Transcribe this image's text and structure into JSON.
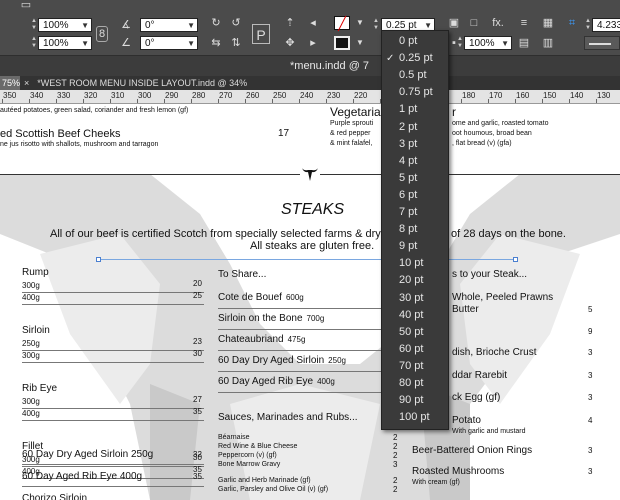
{
  "control_bar": {
    "scale_x": "100%",
    "scale_y": "100%",
    "rotate": "0°",
    "shear": "0°",
    "stroke_weight": "0.25 pt",
    "opacity": "100%",
    "ref_value": "4.233"
  },
  "window": {
    "title": "*menu.indd @ 7"
  },
  "tabs": {
    "active": "75%",
    "close_glyph": "×",
    "doc_tab": "*WEST ROOM MENU INSIDE LAYOUT.indd @ 34%"
  },
  "ruler": {
    "ticks": [
      "350",
      "340",
      "330",
      "320",
      "310",
      "300",
      "290",
      "280",
      "270",
      "260",
      "250",
      "240",
      "230",
      "220",
      "210",
      "200",
      "190",
      "180",
      "170",
      "160",
      "150",
      "140",
      "130"
    ]
  },
  "document": {
    "top_line1": "autéed potatoes, green salad, coriander and fresh lemon (gf)",
    "beef_cheeks": "ed Scottish Beef Cheeks",
    "beef_cheeks_price": "17",
    "beef_cheeks_desc": "ne jus risotto with shallots, mushroom and tarragon",
    "veg_title": "Vegetarian",
    "veg_title_end": "r",
    "veg_l1": "Purple sprouti",
    "veg_l1_end": "ome and garlic, roasted tomato",
    "veg_l2": "& red pepper",
    "veg_l2_end": "oot houmous, broad bean",
    "veg_l3": "& mint falafel,",
    "veg_l3_end": ", flat bread (v) (gfa)",
    "steaks_heading": "STEAKS",
    "intro_l1_a": "All of our beef is certified Scotch from specially selected farms & dry age",
    "intro_l1_b": "of 28 days on the bone.",
    "intro_l2": "All steaks are gluten free.",
    "col1": [
      {
        "name": "Rump",
        "rows": [
          [
            "300g",
            "20"
          ],
          [
            "400g",
            "25"
          ]
        ]
      },
      {
        "name": "Sirloin",
        "rows": [
          [
            "250g",
            "23"
          ],
          [
            "300g",
            "30"
          ]
        ]
      },
      {
        "name": "Rib Eye",
        "rows": [
          [
            "300g",
            "27"
          ],
          [
            "400g",
            "35"
          ]
        ]
      },
      {
        "name": "Fillet",
        "rows": [
          [
            "300g",
            "30"
          ],
          [
            "400g",
            "35"
          ]
        ]
      }
    ],
    "col1_extra": [
      {
        "name": "60 Day Dry Aged Sirloin 250g",
        "price": "32"
      },
      {
        "name": "60 Day Aged Rib Eye 400g",
        "price": "35"
      },
      {
        "name": "Chorizo Sirloin",
        "price": ""
      }
    ],
    "col2_title": "To Share...",
    "col2": [
      {
        "name": "Cote de Bouef",
        "weight": "600g"
      },
      {
        "name": "Sirloin on the Bone",
        "weight": "700g"
      },
      {
        "name": "Chateaubriand",
        "weight": "475g"
      },
      {
        "name": "60 Day Dry Aged Sirloin",
        "weight": "250g"
      },
      {
        "name": "60 Day Aged Rib Eye",
        "weight": "400g"
      }
    ],
    "sauces_title": "Sauces, Marinades and Rubs...",
    "sauces": [
      {
        "name": "Béarnaise",
        "price": "2"
      },
      {
        "name": "Red Wine & Blue Cheese",
        "price": "2"
      },
      {
        "name": "Peppercorn (v) (gf)",
        "price": "2"
      },
      {
        "name": "Bone Marrow Gravy",
        "price": "3"
      },
      {
        "name": "Garlic and Herb Marinade (gf)",
        "price": "2"
      },
      {
        "name": "Garlic, Parsley and Olive Oil (v) (gf)",
        "price": "2"
      }
    ],
    "col3_title": "s to your Steak...",
    "col3": [
      {
        "name": "Whole, Peeled Prawns",
        "price": ""
      },
      {
        "name": "Butter",
        "price": "5"
      },
      {
        "name": "",
        "price": "9"
      },
      {
        "name": "dish, Brioche Crust",
        "price": "3"
      },
      {
        "name": "ddar Rarebit",
        "price": "3"
      },
      {
        "name": "ck Egg (gf)",
        "price": "3"
      },
      {
        "name": "Potato",
        "price": "4"
      },
      {
        "name": "With garlic and mustard",
        "price": ""
      },
      {
        "name": "Beer-Battered Onion Rings",
        "price": "3"
      },
      {
        "name": "Roasted Mushrooms",
        "price": "3"
      },
      {
        "name": "With cream (gf)",
        "price": ""
      }
    ]
  },
  "stroke_menu": {
    "selected": "0.25 pt",
    "items": [
      "0 pt",
      "0.25 pt",
      "0.5 pt",
      "0.75 pt",
      "1 pt",
      "2 pt",
      "3 pt",
      "4 pt",
      "5 pt",
      "6 pt",
      "7 pt",
      "8 pt",
      "9 pt",
      "10 pt",
      "20 pt",
      "30 pt",
      "40 pt",
      "50 pt",
      "60 pt",
      "70 pt",
      "80 pt",
      "90 pt",
      "100 pt"
    ]
  }
}
